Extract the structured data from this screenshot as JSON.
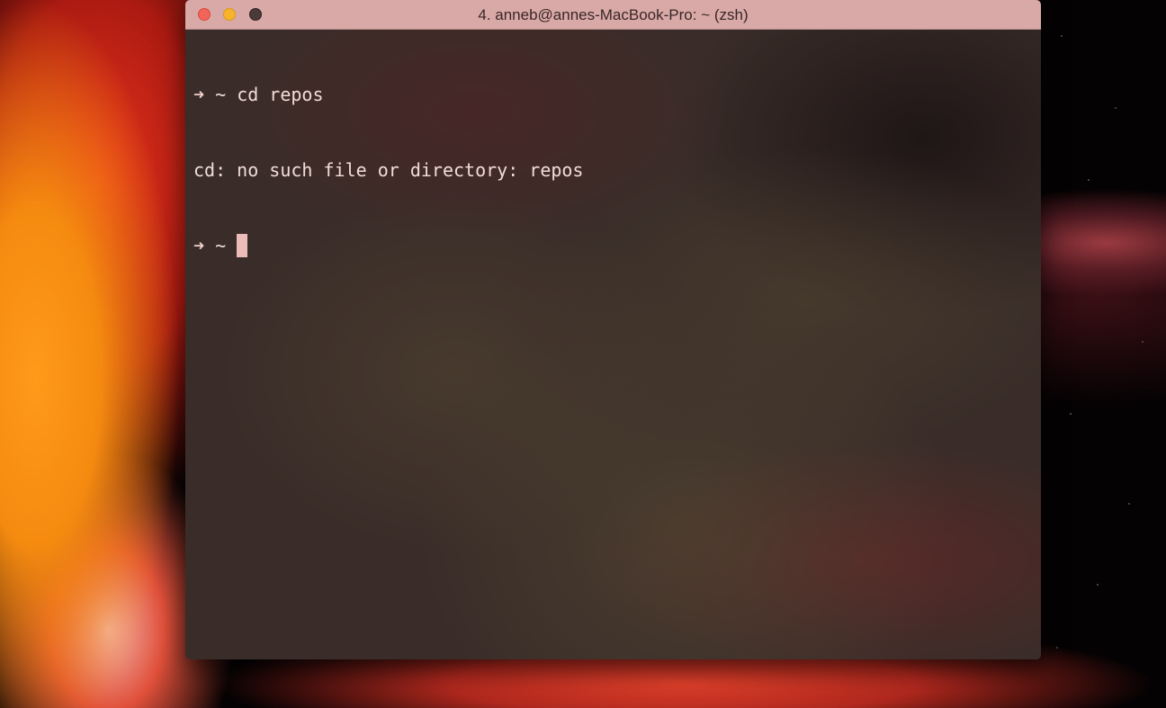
{
  "window": {
    "title": "4. anneb@annes-MacBook-Pro: ~ (zsh)"
  },
  "terminal": {
    "prompt_symbol": "➜",
    "lines": [
      {
        "type": "command",
        "directory": "~",
        "command": "cd repos"
      },
      {
        "type": "output",
        "text": "cd: no such file or directory: repos"
      },
      {
        "type": "prompt",
        "directory": "~",
        "command": ""
      }
    ]
  },
  "colors": {
    "titlebar": "#d8a9a7",
    "close_button": "#f1655a",
    "minimize_button": "#f7b32b",
    "zoom_button": "#4a3a38",
    "terminal_text": "#f2dcd8",
    "cursor": "#ecbcb8"
  },
  "icons": {
    "close": "close-icon",
    "minimize": "minimize-icon",
    "zoom": "zoom-icon"
  }
}
